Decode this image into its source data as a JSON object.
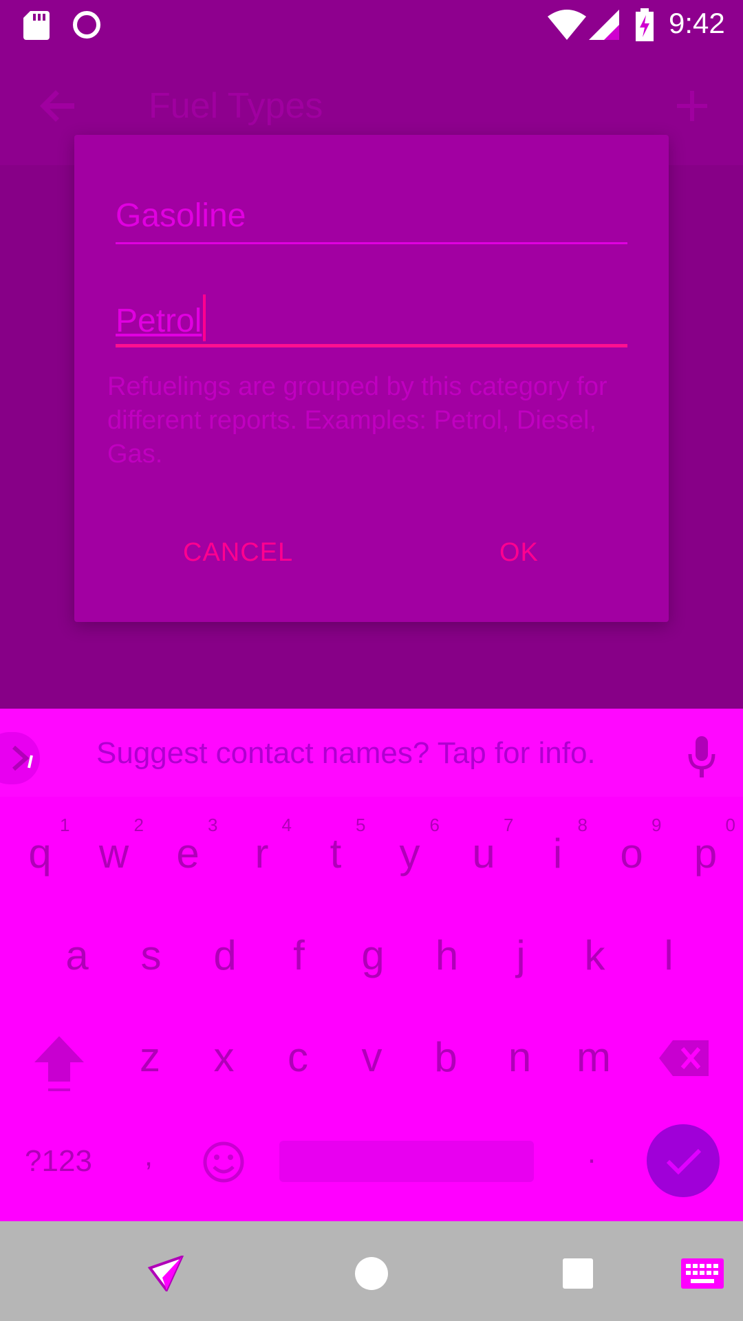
{
  "status_bar": {
    "time": "9:42",
    "icons": [
      "sd-card-icon",
      "circle-status-icon",
      "wifi-icon",
      "cell-signal-icon",
      "battery-charging-icon"
    ]
  },
  "app_bar": {
    "title": "Fuel Types",
    "back_icon": "arrow-back-icon",
    "add_icon": "add-icon"
  },
  "dialog": {
    "name_value": "Gasoline",
    "category_value": "Petrol",
    "helper_text": "Refuelings are grouped by this category for different reports. Examples: Petrol, Diesel, Gas.",
    "cancel_label": "CANCEL",
    "ok_label": "OK"
  },
  "keyboard": {
    "suggestion": "Suggest contact names? Tap for info.",
    "row1": [
      "q",
      "w",
      "e",
      "r",
      "t",
      "y",
      "u",
      "i",
      "o",
      "p"
    ],
    "row1_hints": [
      "1",
      "2",
      "3",
      "4",
      "5",
      "6",
      "7",
      "8",
      "9",
      "0"
    ],
    "row2": [
      "a",
      "s",
      "d",
      "f",
      "g",
      "h",
      "j",
      "k",
      "l"
    ],
    "row3": [
      "z",
      "x",
      "c",
      "v",
      "b",
      "n",
      "m"
    ],
    "symbols_label": "?123",
    "comma_label": ",",
    "period_label": ".",
    "colors": {
      "background": "#ff00ff",
      "action": "#a000d8"
    }
  },
  "nav_bar": {
    "icons": [
      "back-icon",
      "home-icon",
      "recents-icon",
      "keyboard-switch-icon"
    ]
  }
}
